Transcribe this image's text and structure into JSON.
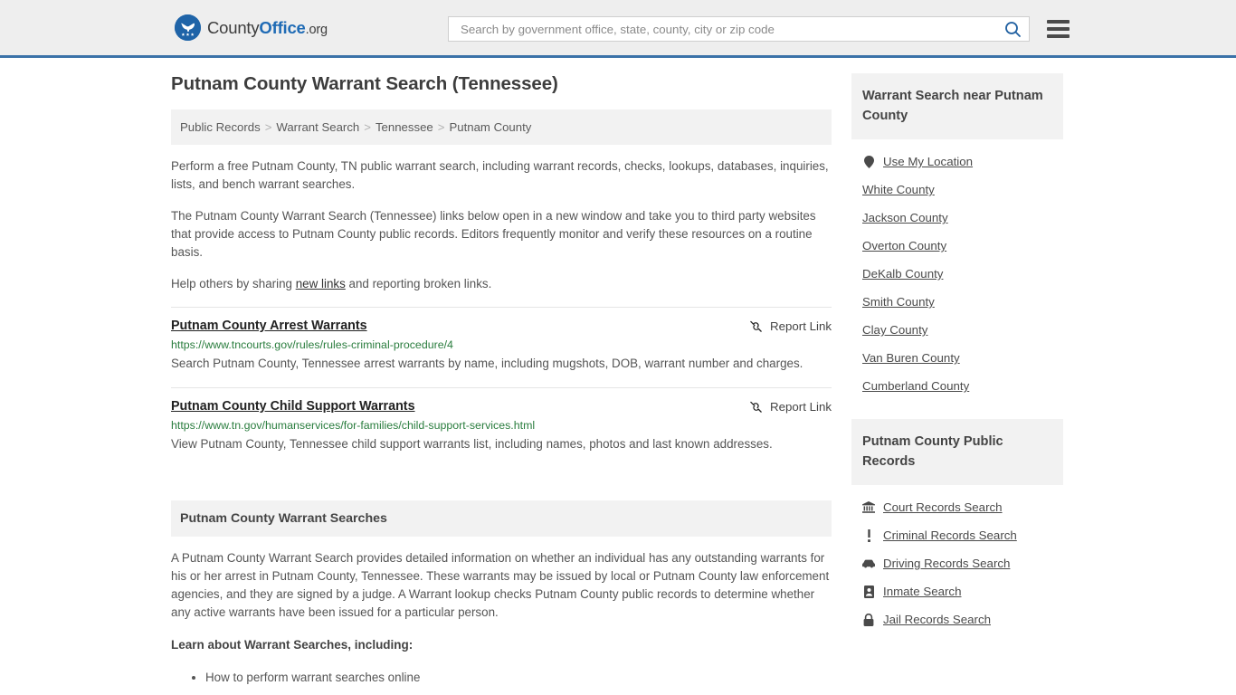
{
  "header": {
    "logo": {
      "part1": "County",
      "part2": "Office",
      "part3": ".org",
      "icon": "eagle-seal-icon"
    },
    "search": {
      "placeholder": "Search by government office, state, county, city or zip code",
      "value": "",
      "button_icon": "search-icon"
    },
    "menu_icon": "hamburger-menu-icon",
    "accent_color": "#3b72a8"
  },
  "main": {
    "title": "Putnam County Warrant Search (Tennessee)",
    "breadcrumb": [
      {
        "label": "Public Records"
      },
      {
        "label": "Warrant Search"
      },
      {
        "label": "Tennessee"
      },
      {
        "label": "Putnam County"
      }
    ],
    "breadcrumb_separator": ">",
    "intro_1": "Perform a free Putnam County, TN public warrant search, including warrant records, checks, lookups, databases, inquiries, lists, and bench warrant searches.",
    "intro_2": "The Putnam County Warrant Search (Tennessee) links below open in a new window and take you to third party websites that provide access to Putnam County public records. Editors frequently monitor and verify these resources on a routine basis.",
    "intro_3_pre": "Help others by sharing ",
    "intro_3_link": "new links",
    "intro_3_post": " and reporting broken links.",
    "report_link_label": "Report Link",
    "report_link_icon": "broken-link-icon",
    "results": [
      {
        "title": "Putnam County Arrest Warrants",
        "url": "https://www.tncourts.gov/rules/rules-criminal-procedure/4",
        "description": "Search Putnam County, Tennessee arrest warrants by name, including mugshots, DOB, warrant number and charges."
      },
      {
        "title": "Putnam County Child Support Warrants",
        "url": "https://www.tn.gov/humanservices/for-families/child-support-services.html",
        "description": "View Putnam County, Tennessee child support warrants list, including names, photos and last known addresses."
      }
    ],
    "section": {
      "heading": "Putnam County Warrant Searches",
      "paragraph": "A Putnam County Warrant Search provides detailed information on whether an individual has any outstanding warrants for his or her arrest in Putnam County, Tennessee. These warrants may be issued by local or Putnam County law enforcement agencies, and they are signed by a judge. A Warrant lookup checks Putnam County public records to determine whether any active warrants have been issued for a particular person.",
      "learn_heading": "Learn about Warrant Searches, including:",
      "learn_items": [
        "How to perform warrant searches online"
      ]
    }
  },
  "sidebar": {
    "near_block": {
      "heading": "Warrant Search near Putnam County",
      "items": [
        {
          "label": "Use My Location",
          "icon": "map-pin-icon"
        },
        {
          "label": "White County",
          "icon": ""
        },
        {
          "label": "Jackson County",
          "icon": ""
        },
        {
          "label": "Overton County",
          "icon": ""
        },
        {
          "label": "DeKalb County",
          "icon": ""
        },
        {
          "label": "Smith County",
          "icon": ""
        },
        {
          "label": "Clay County",
          "icon": ""
        },
        {
          "label": "Van Buren County",
          "icon": ""
        },
        {
          "label": "Cumberland County",
          "icon": ""
        }
      ]
    },
    "records_block": {
      "heading": "Putnam County Public Records",
      "items": [
        {
          "label": "Court Records Search",
          "icon": "courthouse-icon"
        },
        {
          "label": "Criminal Records Search",
          "icon": "exclamation-icon"
        },
        {
          "label": "Driving Records Search",
          "icon": "car-icon"
        },
        {
          "label": "Inmate Search",
          "icon": "id-badge-icon"
        },
        {
          "label": "Jail Records Search",
          "icon": "lock-icon"
        }
      ]
    }
  }
}
